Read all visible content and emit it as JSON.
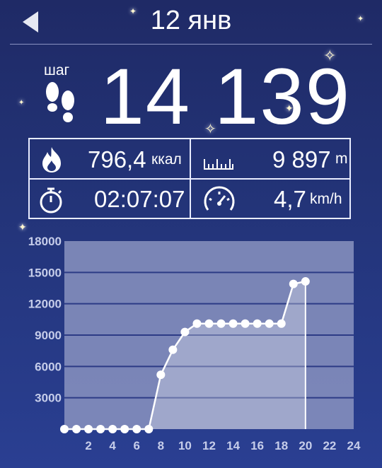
{
  "header": {
    "title": "12 янв"
  },
  "steps": {
    "label": "шаг",
    "value": "14 139"
  },
  "stats": {
    "calories": {
      "value": "796,4",
      "unit": "ккал"
    },
    "distance": {
      "value": "9 897",
      "unit": "m"
    },
    "duration": {
      "value": "02:07:07"
    },
    "speed": {
      "value": "4,7",
      "unit": "km/h"
    }
  },
  "icons": {
    "back": "back-arrow-icon",
    "steps": "footprints-icon",
    "calories": "flame-icon",
    "distance": "ruler-icon",
    "duration": "stopwatch-icon",
    "speed": "speedometer-icon"
  },
  "colors": {
    "background": "#233479",
    "plot_area": "#8a93c0",
    "grid_line": "#2c3b86",
    "line": "#ffffff",
    "tick_label": "#c6cdea"
  },
  "chart_data": {
    "type": "area",
    "title": "",
    "xlabel": "",
    "ylabel": "",
    "x_ticks": [
      2,
      4,
      6,
      8,
      10,
      12,
      14,
      16,
      18,
      20,
      22,
      24
    ],
    "y_ticks": [
      3000,
      6000,
      9000,
      12000,
      15000,
      18000
    ],
    "xlim": [
      0,
      24
    ],
    "ylim": [
      0,
      18000
    ],
    "grid": true,
    "series": [
      {
        "x": [
          0,
          1,
          2,
          3,
          4,
          5,
          6,
          7,
          8,
          9,
          10,
          11,
          12,
          13,
          14,
          15,
          16,
          17,
          18,
          19,
          20
        ],
        "values": [
          0,
          0,
          0,
          0,
          0,
          0,
          0,
          0,
          5200,
          7600,
          9300,
          10100,
          10100,
          10100,
          10100,
          10100,
          10100,
          10100,
          10100,
          13900,
          14139
        ]
      }
    ]
  }
}
